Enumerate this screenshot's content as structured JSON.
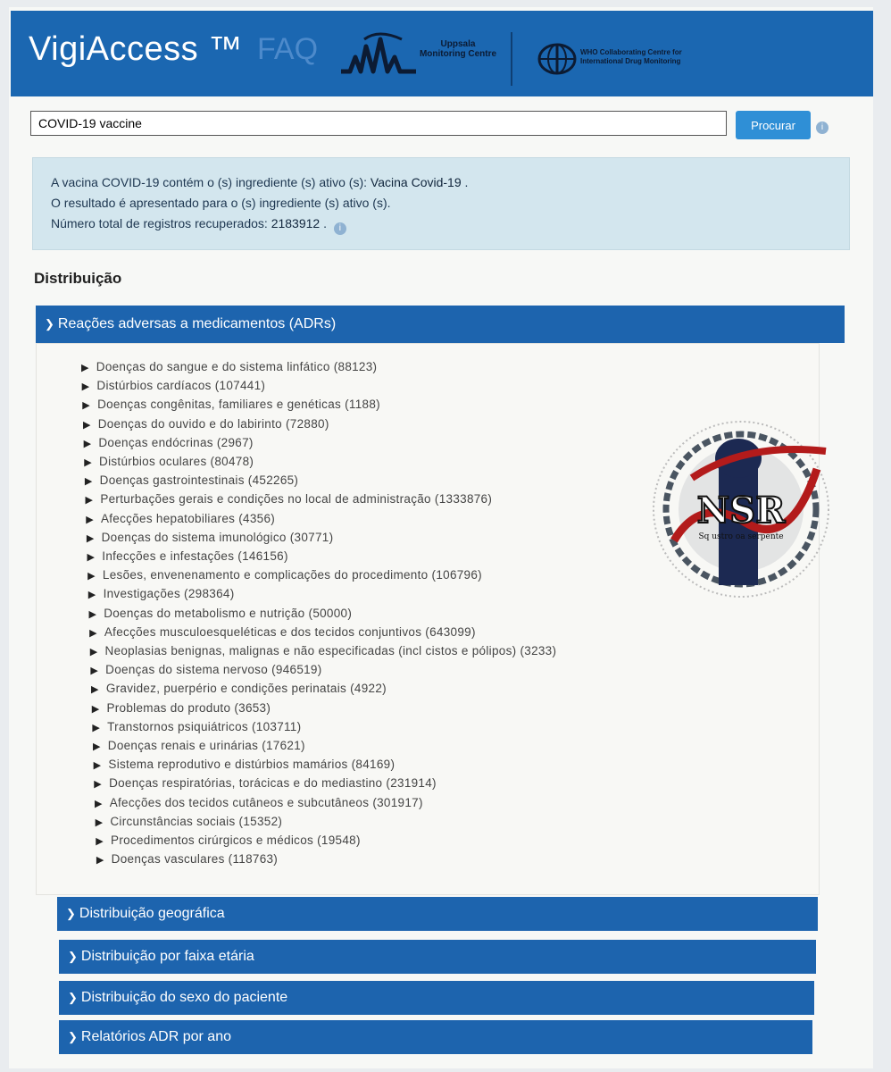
{
  "header": {
    "title": "VigiAccess ™",
    "faq_link": "FAQ",
    "umc_text": "Uppsala Monitoring Centre",
    "who_text": "WHO Collaborating Centre for International Drug Monitoring"
  },
  "search": {
    "value": "COVID-19 vaccine",
    "button_label": "Procurar",
    "info_icon": "info-icon"
  },
  "result": {
    "line1_prefix": "A vacina COVID-19 contém o (s) ingrediente (s) ativo (s):",
    "line1_value": "Vacina Covid-19",
    "line1_suffix": ".",
    "line2": "O resultado é apresentado para o (s) ingrediente (s) ativo (s).",
    "line3_prefix": "Número total de registros recuperados:",
    "line3_value": "2183912",
    "line3_suffix": "."
  },
  "distribution": {
    "title": "Distribuição",
    "adr_header": "Reações adversas a medicamentos (ADRs)",
    "adr_items": [
      "Doenças do sangue e do sistema linfático (88123)",
      "Distúrbios cardíacos (107441)",
      "Doenças congênitas, familiares e genéticas (1188)",
      "Doenças do ouvido e do labirinto (72880)",
      "Doenças endócrinas (2967)",
      "Distúrbios oculares (80478)",
      "Doenças gastrointestinais (452265)",
      "Perturbações gerais e condições no local de administração (1333876)",
      "Afecções hepatobiliares (4356)",
      "Doenças do sistema imunológico (30771)",
      "Infecções e infestações (146156)",
      "Lesões, envenenamento e complicações do procedimento (106796)",
      "Investigações (298364)",
      "Doenças do metabolismo e nutrição (50000)",
      "Afecções musculoesqueléticas e dos tecidos conjuntivos (643099)",
      "Neoplasias benignas, malignas e não especificadas (incl cistos e pólipos) (3233)",
      "Doenças do sistema nervoso (946519)",
      "Gravidez, puerpério e condições perinatais (4922)",
      "Problemas do produto (3653)",
      "Transtornos psiquiátricos (103711)",
      "Doenças renais e urinárias (17621)",
      "Sistema reprodutivo e distúrbios mamários (84169)",
      "Doenças respiratórias, torácicas e do mediastino (231914)",
      "Afecções dos tecidos cutâneos e subcutâneos (301917)",
      "Circunstâncias sociais (15352)",
      "Procedimentos cirúrgicos e médicos (19548)",
      "Doenças vasculares (118763)"
    ],
    "geo_header": "Distribuição geográfica",
    "age_header": "Distribuição por faixa etária",
    "sex_header": "Distribuição do sexo do paciente",
    "year_header": "Relatórios ADR por ano"
  },
  "watermark": {
    "text": "NSR",
    "subtext": "Sq ustro oa serpente"
  },
  "colors": {
    "header_bg": "#1b67b1",
    "accordion_bg": "#1d64ae",
    "result_bg": "#d3e6ee",
    "button_bg": "#2f8fd6"
  }
}
